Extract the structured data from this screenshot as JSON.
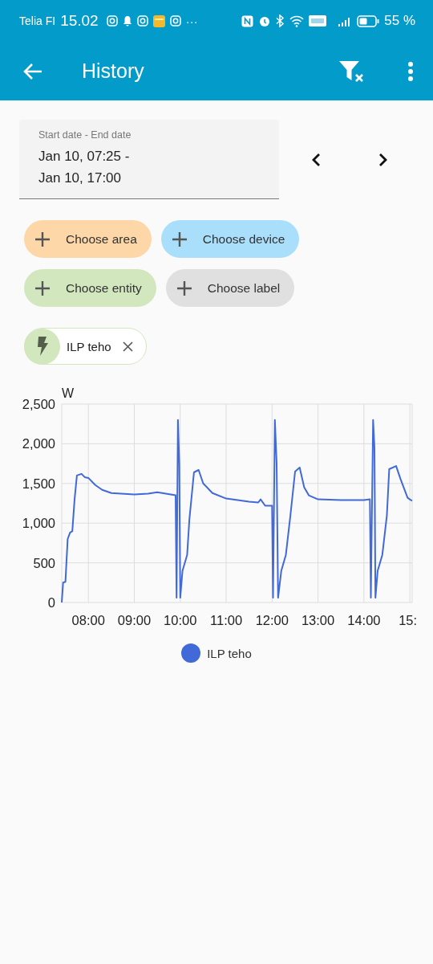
{
  "status_bar": {
    "carrier": "Telia FI",
    "time": "15.02",
    "more": "···",
    "battery": "55 %"
  },
  "app_bar": {
    "title": "History"
  },
  "date_range": {
    "label": "Start date - End date",
    "value_lines": [
      "Jan 10, 07:25 -",
      "Jan 10, 17:00"
    ]
  },
  "target_chips": [
    {
      "label": "Choose area",
      "color": "#fdd7a7"
    },
    {
      "label": "Choose device",
      "color": "#a9dffb"
    },
    {
      "label": "Choose entity",
      "color": "#d3e7bf"
    },
    {
      "label": "Choose label",
      "color": "#e0e0e0"
    }
  ],
  "selected_entities": [
    {
      "label": "ILP teho"
    }
  ],
  "chart": {
    "chart_data": {
      "type": "line",
      "grid": true,
      "ylabel": "W",
      "xlim": [
        7.42,
        15.05
      ],
      "ylim": [
        0,
        2500
      ],
      "yticks": [
        {
          "value": 0,
          "label": "0"
        },
        {
          "value": 500,
          "label": "500"
        },
        {
          "value": 1000,
          "label": "1,000"
        },
        {
          "value": 1500,
          "label": "1,500"
        },
        {
          "value": 2000,
          "label": "2,000"
        },
        {
          "value": 2500,
          "label": "2,500"
        }
      ],
      "xticks": [
        {
          "value": 8,
          "label": "08:00"
        },
        {
          "value": 9,
          "label": "09:00"
        },
        {
          "value": 10,
          "label": "10:00"
        },
        {
          "value": 11,
          "label": "11:00"
        },
        {
          "value": 12,
          "label": "12:00"
        },
        {
          "value": 13,
          "label": "13:00"
        },
        {
          "value": 14,
          "label": "14:00"
        },
        {
          "value": 15,
          "label": "15:"
        }
      ],
      "x": [
        7.42,
        7.45,
        7.5,
        7.55,
        7.6,
        7.65,
        7.7,
        7.75,
        7.85,
        7.92,
        8.0,
        8.15,
        8.3,
        8.5,
        9.0,
        9.3,
        9.5,
        9.9,
        9.92,
        9.95,
        9.98,
        10.0,
        10.05,
        10.15,
        10.2,
        10.3,
        10.4,
        10.5,
        10.7,
        11.0,
        11.5,
        11.7,
        11.75,
        11.85,
        12.0,
        12.02,
        12.06,
        12.1,
        12.13,
        12.2,
        12.3,
        12.4,
        12.5,
        12.6,
        12.7,
        12.8,
        13.0,
        13.5,
        14.0,
        14.13,
        14.15,
        14.2,
        14.23,
        14.25,
        14.3,
        14.4,
        14.5,
        14.55,
        14.7,
        14.8,
        14.95,
        15.0,
        15.05
      ],
      "series": [
        {
          "name": "ILP teho",
          "color": "#4169d8",
          "values": [
            0,
            250,
            260,
            800,
            880,
            900,
            1300,
            1600,
            1620,
            1580,
            1570,
            1480,
            1420,
            1380,
            1360,
            1370,
            1390,
            1350,
            60,
            2300,
            1750,
            60,
            400,
            600,
            1050,
            1640,
            1670,
            1500,
            1380,
            1310,
            1270,
            1260,
            1300,
            1220,
            1220,
            60,
            2300,
            1750,
            60,
            400,
            600,
            1100,
            1650,
            1700,
            1450,
            1350,
            1300,
            1290,
            1290,
            1300,
            60,
            2300,
            1950,
            60,
            400,
            600,
            1100,
            1680,
            1720,
            1550,
            1320,
            1300,
            1280
          ]
        }
      ]
    }
  }
}
